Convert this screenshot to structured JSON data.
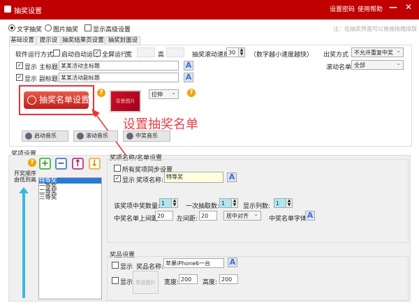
{
  "window": {
    "title": "抽奖设置",
    "set_password": "设置密码",
    "help": "使用帮助",
    "minimize": "—",
    "close": "✕"
  },
  "mode": {
    "text_draw": "文字抽奖",
    "image_draw": "图片抽奖",
    "show_advanced": "显示高级设置",
    "note": "注：在抽奖界面可以直接拖拽排版"
  },
  "tabs": [
    "基础设置",
    "提示设置",
    "抽奖结果页设置",
    "抽奖封面设置"
  ],
  "basic": {
    "run_mode_label": "软件运行方式",
    "auto_run": "启动自动运行",
    "fullscreen": "全屏运行",
    "width_label": "宽",
    "height_label": "高",
    "speed_label": "抽奖滚动速度",
    "speed_value": "30",
    "speed_hint": "（数字越小速度越快）",
    "draw_mode_label": "出奖方式",
    "draw_mode_value": "不允许重复中奖",
    "scroll_list_label": "滚动名单",
    "scroll_list_value": "全部",
    "show": "显示",
    "main_title_label": "主标题",
    "main_title_value": "某某活动主标题",
    "sub_title_label": "副标题",
    "sub_title_value": "某某活动副标题",
    "list_button": "抽奖名单设置",
    "bg_image": "背景图片",
    "stretch_value": "拉伸",
    "music": [
      "启动音乐",
      "滚动音乐",
      "中奖音乐"
    ]
  },
  "annotation": "设置抽奖名单",
  "prizes": {
    "section_label": "奖项设置",
    "order_line1": "开奖顺序",
    "order_line2": "由低到高",
    "items": [
      "特等奖",
      "一等奖",
      "二等奖",
      "三等奖"
    ],
    "selected": 0,
    "name_group": "奖项名称/名单设置",
    "sync_all": "所有奖项同步设置",
    "show": "显示",
    "name_label": "奖项名称:",
    "name_value": "特等奖",
    "count_label": "该奖项中奖数量:",
    "count_value": "1",
    "per_draw_label": "一次抽取数:",
    "per_draw_value": "1",
    "columns_label": "显示列数:",
    "columns_value": "1",
    "top_gap_label": "中奖名单上间距:",
    "top_gap_value": "20",
    "left_gap_label": "左间距:",
    "left_gap_value": "20",
    "align_value": "居中对齐",
    "font_label": "中奖名单字体",
    "award_group": "奖品设置",
    "award_name_label": "奖品名称:",
    "award_name_value": "苹果iPhone6一台",
    "award_image": "奖品图片",
    "width_label": "宽度:",
    "width_value": "200",
    "height_label": "高度:",
    "height_value": "200"
  },
  "colors": {
    "titlebar": "#c00000",
    "accent_red": "#e23a3a"
  }
}
